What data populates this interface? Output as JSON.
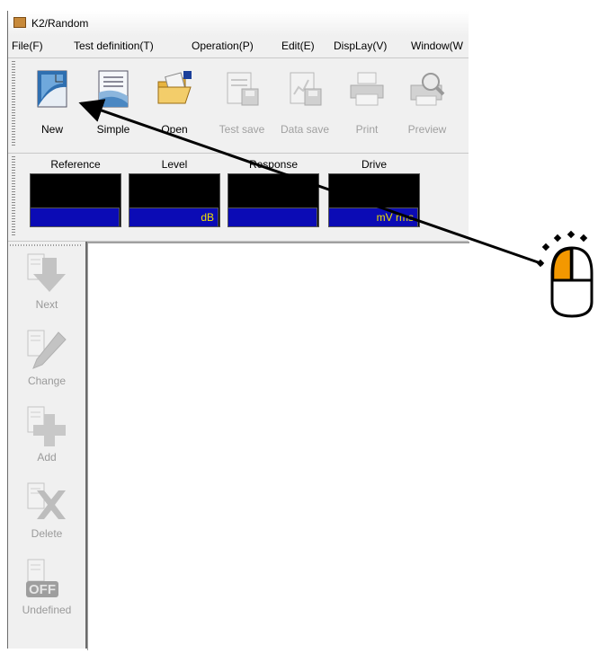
{
  "window": {
    "title": "K2/Random"
  },
  "menu": [
    "File(F)",
    "Test definition(T)",
    "Operation(P)",
    "Edit(E)",
    "DispLay(V)",
    "Window(W"
  ],
  "toolbar": {
    "new": "New",
    "simple": "Simple",
    "open": "Open",
    "test_save": "Test save",
    "data_save": "Data save",
    "print": "Print",
    "preview": "Preview"
  },
  "meters": [
    {
      "label": "Reference",
      "unit": ""
    },
    {
      "label": "Level",
      "unit": "dB"
    },
    {
      "label": "Response",
      "unit": ""
    },
    {
      "label": "Drive",
      "unit": "mV rms"
    }
  ],
  "side": {
    "next": "Next",
    "change": "Change",
    "add": "Add",
    "delete": "Delete",
    "undefined": "Undefined",
    "off_badge": "OFF"
  },
  "colors": {
    "meter_screen": "#000000",
    "meter_unit_bg": "#0b0bb5",
    "meter_unit_text": "#f0e000",
    "mouse_button": "#f39800"
  }
}
